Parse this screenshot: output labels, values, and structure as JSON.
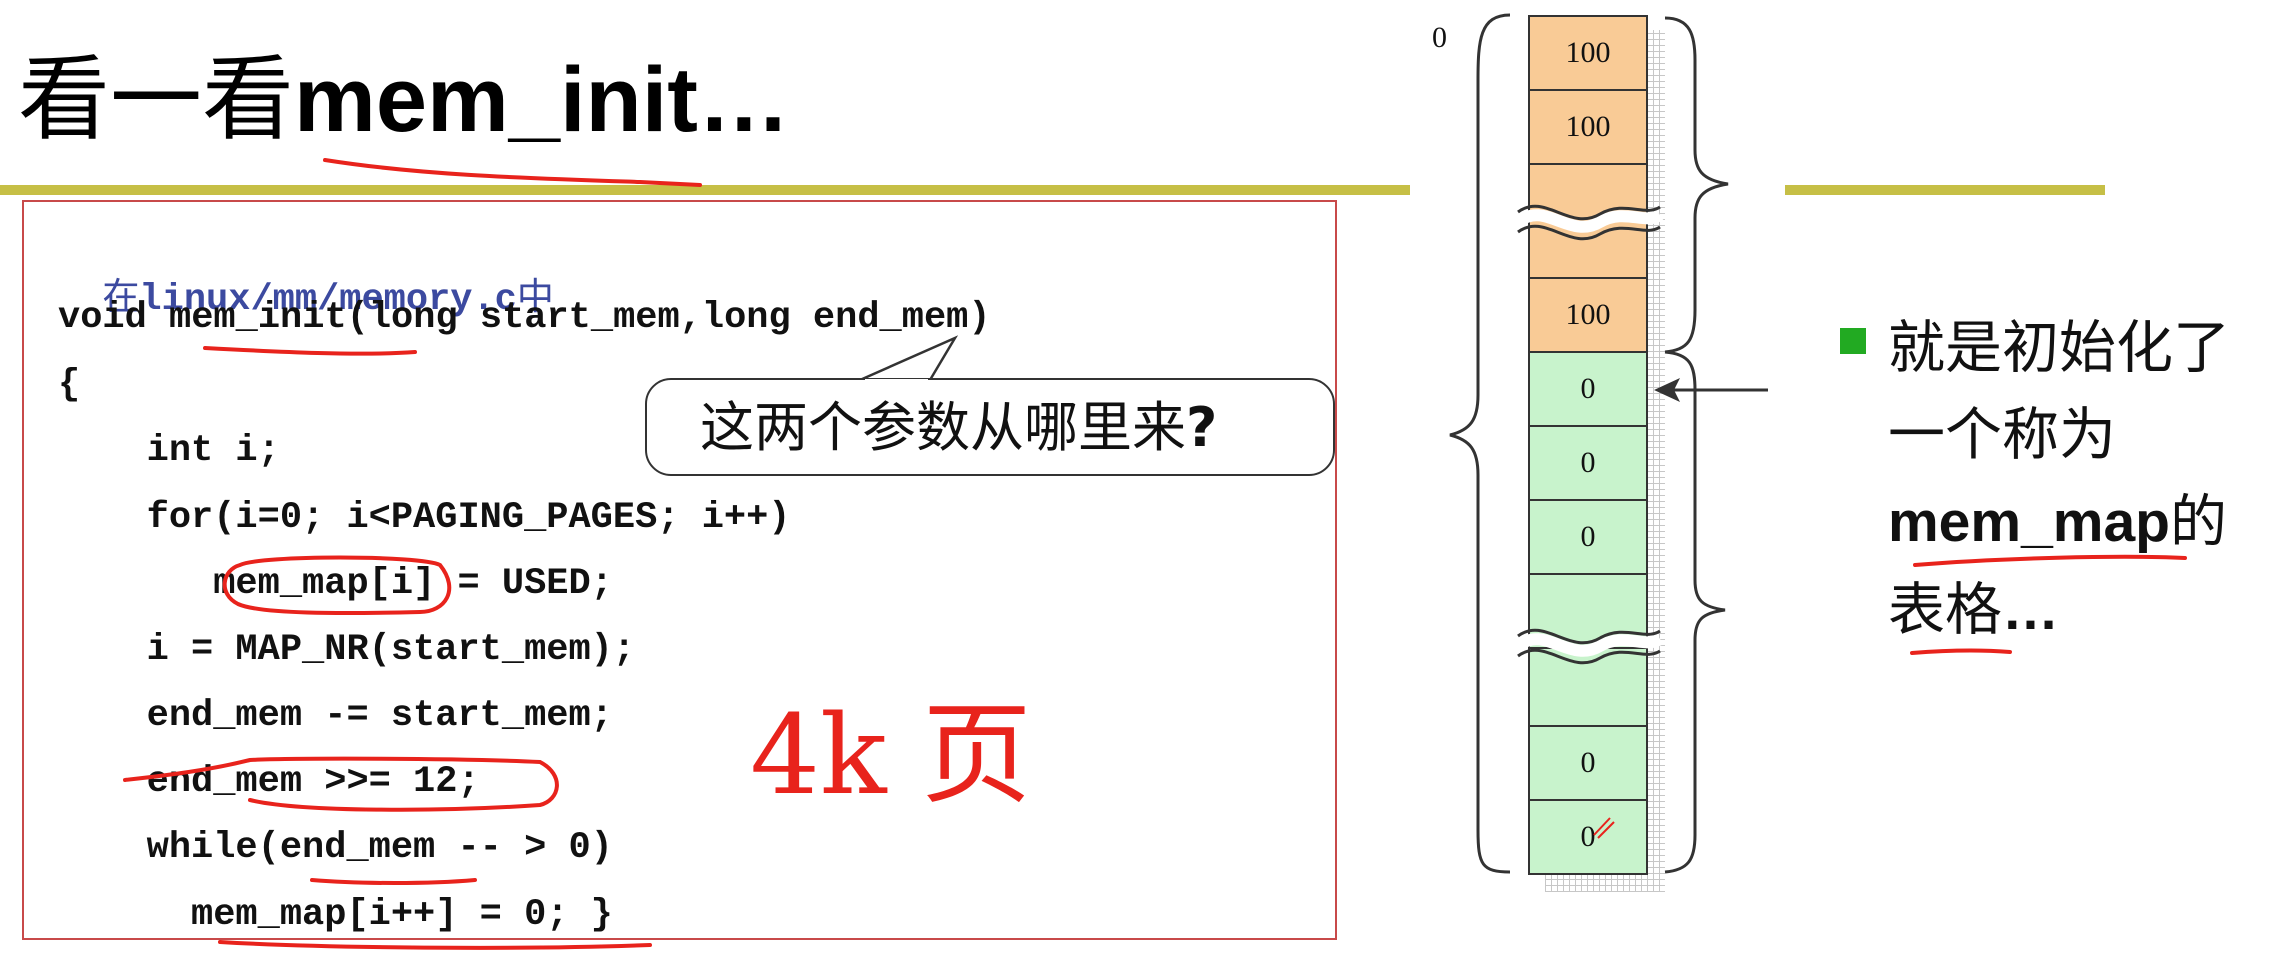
{
  "slide": {
    "title_cn": "看一看",
    "title_code": "mem_init…"
  },
  "code": {
    "path_prefix": "在",
    "path": "linux/mm/memory.c",
    "path_suffix": "中",
    "lines": [
      "void mem_init(long start_mem,long end_mem)",
      "{",
      "   int i;",
      "   for(i=0; i<PAGING_PAGES; i++)",
      "      mem_map[i] = USED;",
      "   i = MAP_NR(start_mem);",
      "   end_mem -= start_mem;",
      "   end_mem >>= 12;",
      "   while(end_mem -- > 0)",
      "     mem_map[i++] = 0; }"
    ]
  },
  "callout": {
    "text": "这两个参数从哪里来",
    "mark": "?"
  },
  "handwriting": {
    "note": "4k 页"
  },
  "diagram": {
    "origin_label": "0",
    "cells": [
      {
        "label": "100",
        "state": "used"
      },
      {
        "label": "100",
        "state": "used"
      },
      {
        "label": "",
        "state": "used"
      },
      {
        "label": "100",
        "state": "used"
      },
      {
        "label": "0",
        "state": "free"
      },
      {
        "label": "0",
        "state": "free"
      },
      {
        "label": "0",
        "state": "free"
      },
      {
        "label": "",
        "state": "free"
      },
      {
        "label": "",
        "state": "free"
      },
      {
        "label": "0",
        "state": "free"
      },
      {
        "label": "0",
        "state": "free"
      }
    ],
    "colors": {
      "used": "#f9cb96",
      "free": "#c8f3cc"
    }
  },
  "side_note": {
    "line1": "就是初始化了",
    "line2": "一个称为",
    "line3_code": "mem_map",
    "line3_suffix": "的",
    "line4": "表格",
    "line4_suffix": "…"
  },
  "colors": {
    "accent_rule": "#c6bf46",
    "ink_red": "#e8231c",
    "bullet": "#22aa22",
    "path_blue": "#3c4aa0"
  }
}
